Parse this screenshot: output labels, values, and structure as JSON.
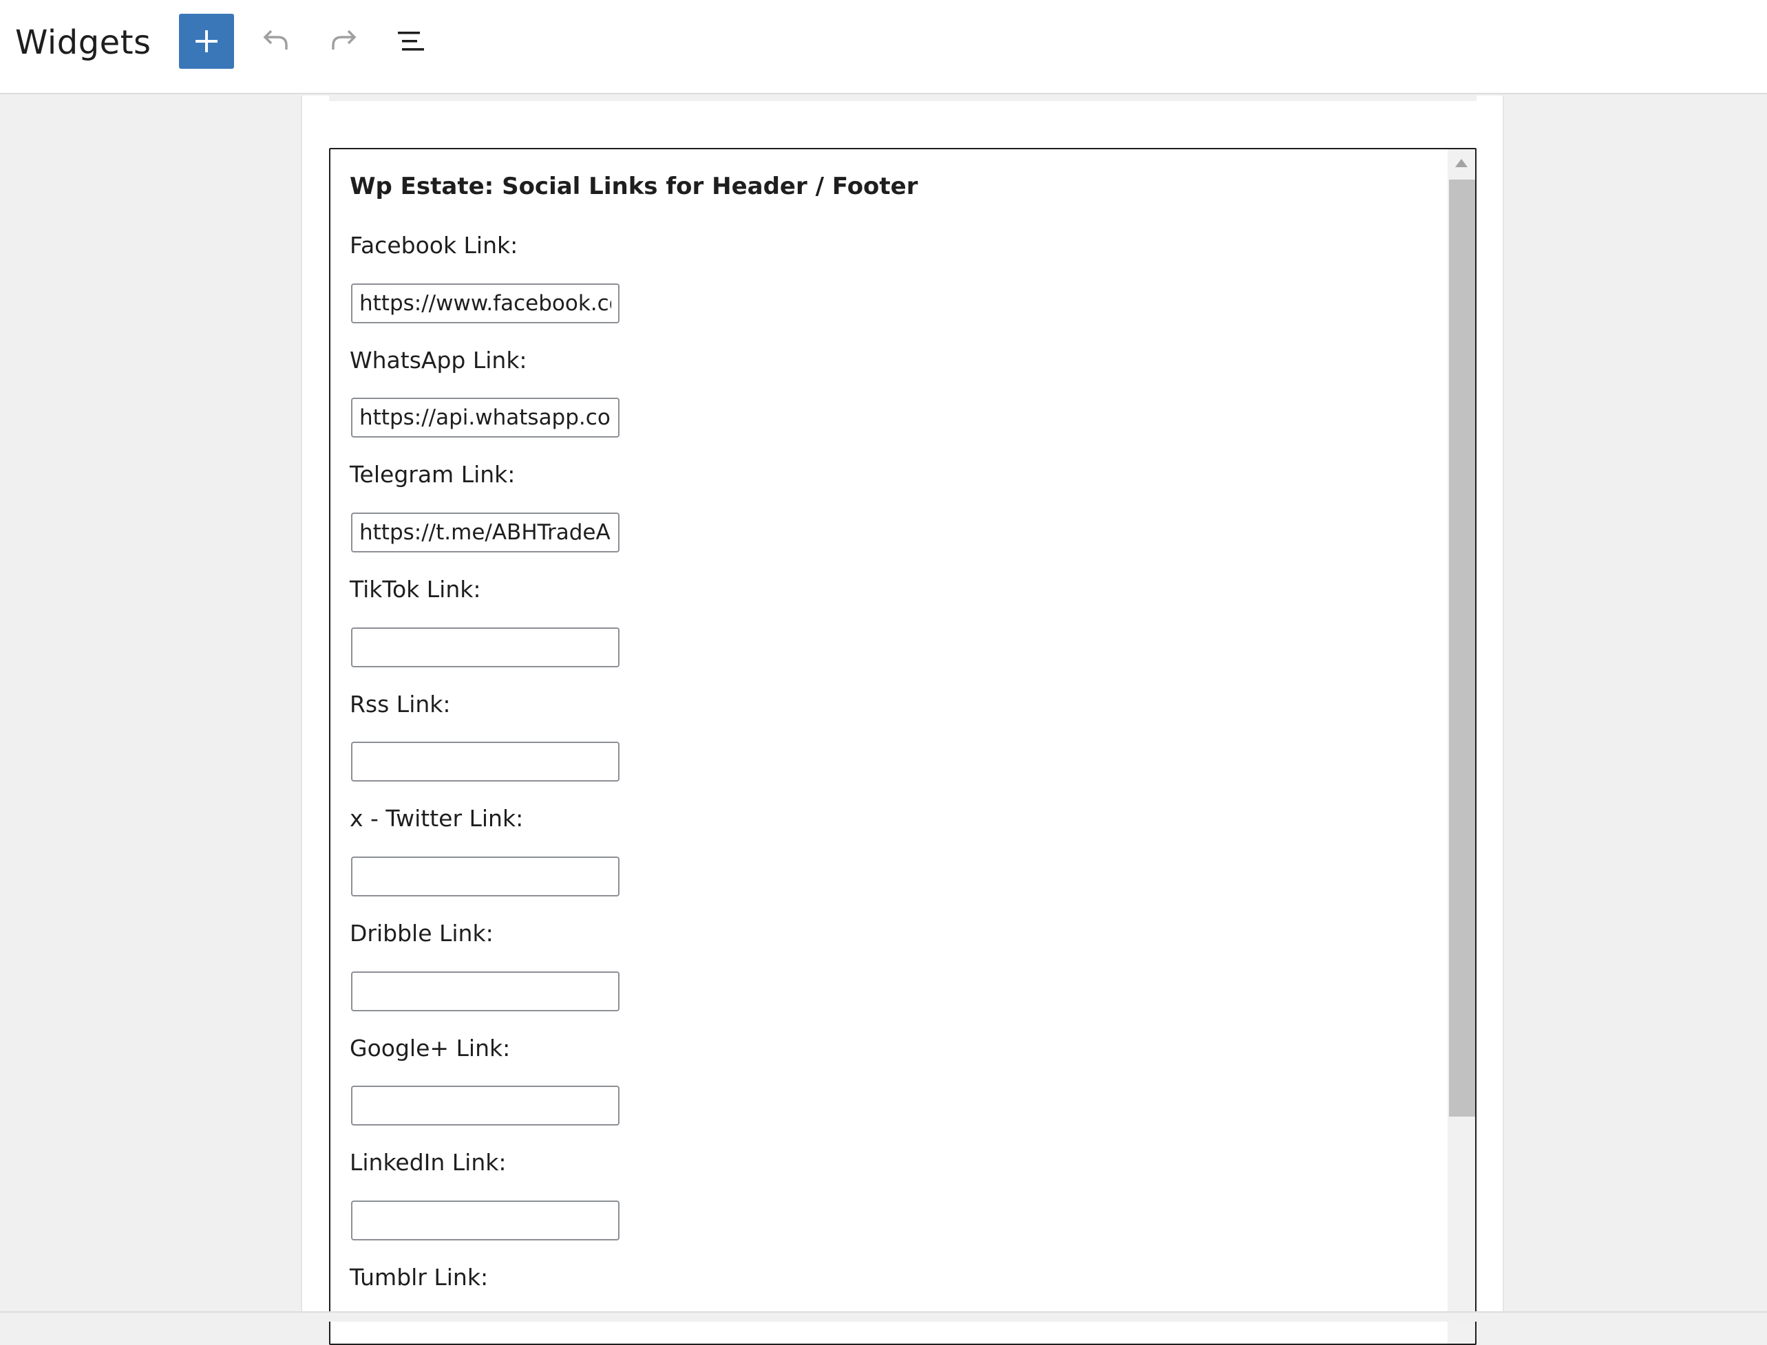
{
  "header": {
    "title": "Widgets",
    "add_block_icon": "plus-icon",
    "undo_icon": "undo-icon",
    "redo_icon": "redo-icon",
    "list_view_icon": "list-view-icon",
    "accent_color": "#3a77b9"
  },
  "widget": {
    "title": "Wp Estate: Social Links for Header / Footer",
    "fields": [
      {
        "label": "Facebook Link:",
        "value": "https://www.facebook.com/"
      },
      {
        "label": "WhatsApp Link:",
        "value": "https://api.whatsapp.com/"
      },
      {
        "label": "Telegram Link:",
        "value": "https://t.me/ABHTradeAR"
      },
      {
        "label": "TikTok Link:",
        "value": ""
      },
      {
        "label": "Rss Link:",
        "value": ""
      },
      {
        "label": "x - Twitter Link:",
        "value": ""
      },
      {
        "label": "Dribble Link:",
        "value": ""
      },
      {
        "label": "Google+ Link:",
        "value": ""
      },
      {
        "label": "LinkedIn Link:",
        "value": ""
      },
      {
        "label": "Tumblr Link:",
        "value": ""
      }
    ]
  }
}
